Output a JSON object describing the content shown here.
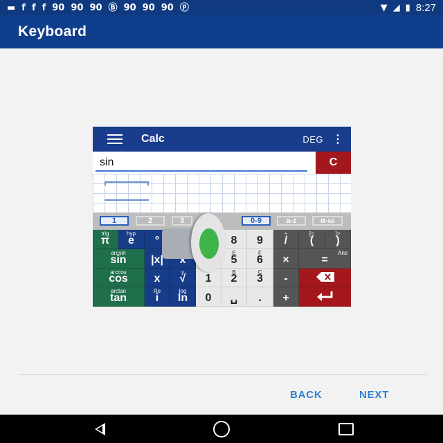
{
  "status_bar": {
    "icons": [
      "message-icon",
      "facebook-icon",
      "facebook-icon",
      "facebook-icon",
      "ninety-icon",
      "ninety-icon",
      "ninety-icon",
      "b-circle-icon",
      "ninety-icon",
      "ninety-icon",
      "ninety-icon",
      "pinterest-icon",
      "wifi-icon",
      "signal-icon",
      "battery-charging-icon"
    ],
    "time": "8:27"
  },
  "app_bar": {
    "title": "Keyboard"
  },
  "illustration": {
    "toolbar": {
      "title": "Calc",
      "angle_mode": "DEG"
    },
    "input": {
      "value": "sin",
      "clear_label": "C"
    },
    "keyboard_tabs": [
      "1",
      "2",
      "3",
      "0-9",
      "a-z",
      "α-ω"
    ],
    "active_tabs": [
      "1",
      "0-9"
    ],
    "keys": [
      {
        "label": "π",
        "sup": "trig"
      },
      {
        "label": "e",
        "sup": "hyp"
      },
      {
        "label": "°",
        "sup": ""
      },
      {
        "label": "8",
        "sup": ""
      },
      {
        "label": "9",
        "sup": ""
      },
      {
        "label": "/",
        "sup": "÷"
      },
      {
        "label": "(",
        "sup": "[<"
      },
      {
        "label": ")",
        "sup": "]>"
      },
      {
        "label": "sin",
        "sup": "arcsin"
      },
      {
        "label": "|x|",
        "sup": ""
      },
      {
        "label": "x",
        "sup": ""
      },
      {
        "label": "5",
        "sup": "E"
      },
      {
        "label": "6",
        "sup": "F"
      },
      {
        "label": "×",
        "sup": ""
      },
      {
        "label": "=",
        "sup": "Ans"
      },
      {
        "label": "cos",
        "sup": "arccos"
      },
      {
        "label": "x",
        "sup": ""
      },
      {
        "label": "√",
        "sup": "y"
      },
      {
        "label": "1",
        "sup": ""
      },
      {
        "label": "2",
        "sup": "B"
      },
      {
        "label": "3",
        "sup": "C"
      },
      {
        "label": "-",
        "sup": ""
      },
      {
        "label": "backspace-icon",
        "sup": ""
      },
      {
        "label": "tan",
        "sup": "arctan"
      },
      {
        "label": "i",
        "sup": "Re"
      },
      {
        "label": "ln",
        "sup": "log"
      },
      {
        "label": "0",
        "sup": ""
      },
      {
        "label": "␣",
        "sup": ""
      },
      {
        "label": ".",
        "sup": ""
      },
      {
        "label": "+",
        "sup": ""
      },
      {
        "label": "enter-icon",
        "sup": ""
      }
    ]
  },
  "footer": {
    "back_label": "BACK",
    "next_label": "NEXT"
  },
  "system_nav": {
    "back": "back-triangle-icon",
    "home": "home-circle-icon",
    "recents": "recents-square-icon"
  },
  "colors": {
    "app_bar": "#0f3f8c",
    "accent": "#2b7fd0",
    "calc_green": "#1f6e4c",
    "calc_blue": "#173d88",
    "calc_red": "#a3171d"
  }
}
